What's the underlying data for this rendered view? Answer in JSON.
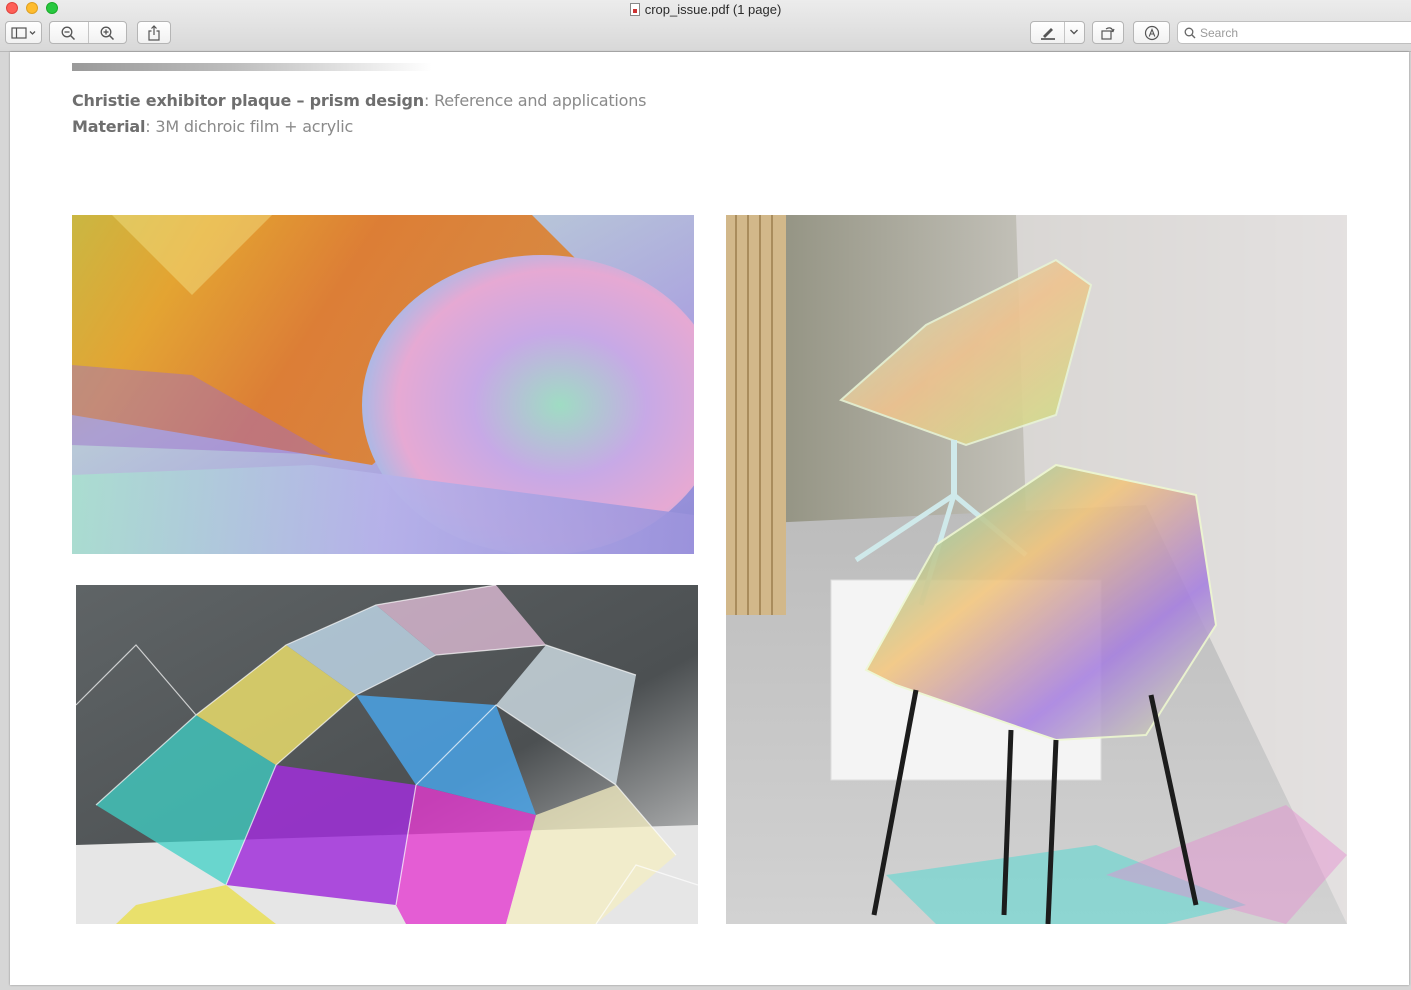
{
  "window": {
    "title": "crop_issue.pdf (1 page)",
    "title_icon": "pdf-document-icon"
  },
  "toolbar": {
    "sidebar_icon": "sidebar-toggle-icon",
    "zoom_out_icon": "zoom-out-icon",
    "zoom_in_icon": "zoom-in-icon",
    "share_icon": "share-icon",
    "markup_icon": "pen-icon",
    "markup_menu_icon": "chevron-down-icon",
    "rotate_icon": "rotate-icon",
    "annotate_icon": "markup-circle-icon",
    "search_placeholder": "Search"
  },
  "document": {
    "caption_line1_bold": "Christie exhibitor plaque – prism design",
    "caption_line1_rest": ": Reference and applications",
    "caption_line2_bold": "Material",
    "caption_line2_rest": ": 3M dichroic film + acrylic",
    "images": [
      "dichroic-film-roll-photo",
      "dichroic-sculpture-photo",
      "dichroic-acrylic-chairs-photo"
    ]
  },
  "colors": {
    "caption_bold": "#6e6e6e",
    "caption_text": "#8a8a8a",
    "close": "#fe5f57",
    "minimize": "#febc2e",
    "maximize": "#28c840"
  }
}
